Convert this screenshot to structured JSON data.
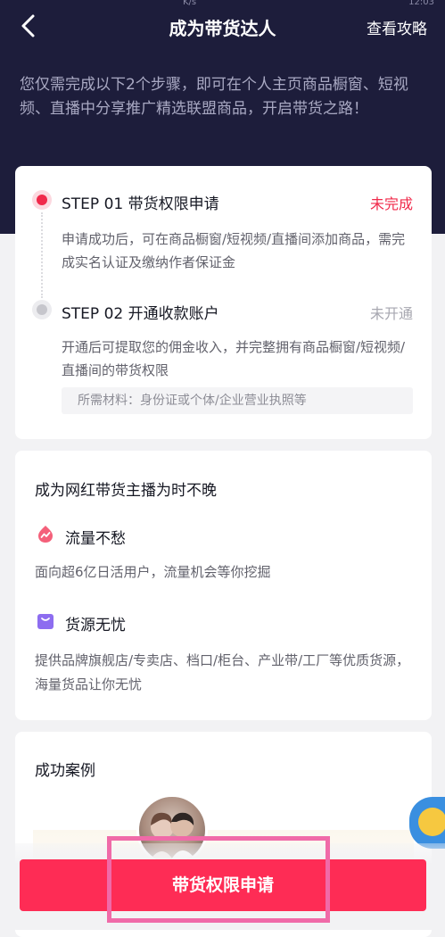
{
  "status_bar": {
    "signal": "K/s",
    "time": "12:03"
  },
  "nav": {
    "title": "成为带货达人",
    "right_link": "查看攻略"
  },
  "intro": "您仅需完成以下2个步骤，即可在个人主页商品橱窗、短视频、直播中分享推广精选联盟商品，开启带货之路！",
  "steps": [
    {
      "title": "STEP 01 带货权限申请",
      "status": "未完成",
      "desc": "申请成功后，可在商品橱窗/短视频/直播间添加商品，需完成实名认证及缴纳作者保证金"
    },
    {
      "title": "STEP 02 开通收款账户",
      "status": "未开通",
      "desc": "开通后可提取您的佣金收入，并完整拥有商品橱窗/短视频/直播间的带货权限",
      "materials": "所需材料：身份证或个体/企业营业执照等"
    }
  ],
  "benefits": {
    "title": "成为网红带货主播为时不晚",
    "items": [
      {
        "icon": "traffic-icon",
        "title": "流量不愁",
        "desc": "面向超6亿日活用户，流量机会等你挖掘"
      },
      {
        "icon": "shopping-bag-icon",
        "title": "货源无忧",
        "desc": "提供品牌旗舰店/专卖店、档口/柜台、产业带/工厂等优质货源，海量货品让你无忧"
      }
    ]
  },
  "cases": {
    "title": "成功案例"
  },
  "apply_button": "带货权限申请",
  "colors": {
    "hero_bg": "#1d1d3b",
    "accent": "#fe2c55",
    "status_red": "#f0294a",
    "highlight": "#f06aa8"
  }
}
